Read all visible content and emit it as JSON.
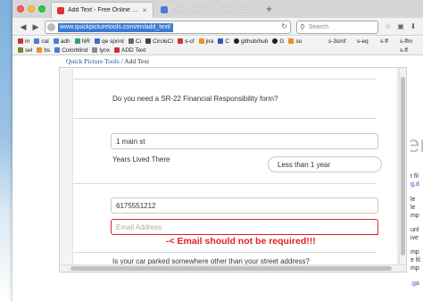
{
  "browser": {
    "tabs": [
      {
        "label": "Add Text - Free Online Tool to A...",
        "active": true
      },
      {
        "label": "Edit - Software Quality Assu...",
        "active": false
      }
    ],
    "new_tab_glyph": "+",
    "url": "www.quickpicturetools.com/en/add_text/",
    "search_placeholder": "Search",
    "bookmarks_row1": [
      "m",
      "cal",
      "adh",
      "NR",
      "qe sprint",
      "Ci",
      "CircleCI",
      "s-cf",
      "jira",
      "C",
      "github/hub",
      "G",
      "so"
    ],
    "bookmarks_row1_right": [
      "s-3smf",
      "s-eq",
      "s-ff",
      "s-ffm"
    ],
    "bookmarks_row2": [
      "sel",
      "bs",
      "Colorblind",
      "lynx",
      "ADD Text"
    ],
    "bookmarks_row2_right": [
      "s-ff"
    ]
  },
  "page": {
    "breadcrumb": {
      "link": "Quick Picture Tools",
      "separator": "/",
      "current": "Add Text"
    },
    "form": {
      "q1": "Do you need a SR-22 Financial Responsibility form?",
      "address_value": "1 main st",
      "years_label": "Years Lived There",
      "years_value": "Less than 1 year",
      "phone_value": "6175551212",
      "email_placeholder": "Email Address",
      "q2": "Is your car parked somewhere other than your street address?"
    },
    "annotation": "-< Email should not be required!!!",
    "right_partial": {
      "big_glyph": "er",
      "lines": [
        "t fil",
        "g,d",
        "le",
        "le",
        "mp",
        "unl",
        "ive",
        "mp",
        "e fil",
        "mp",
        ".ga"
      ]
    }
  },
  "colors": {
    "url_highlight": "#3d7ad5",
    "error_border": "#d62b2b",
    "annotation": "#e02222",
    "link": "#2251a5"
  }
}
